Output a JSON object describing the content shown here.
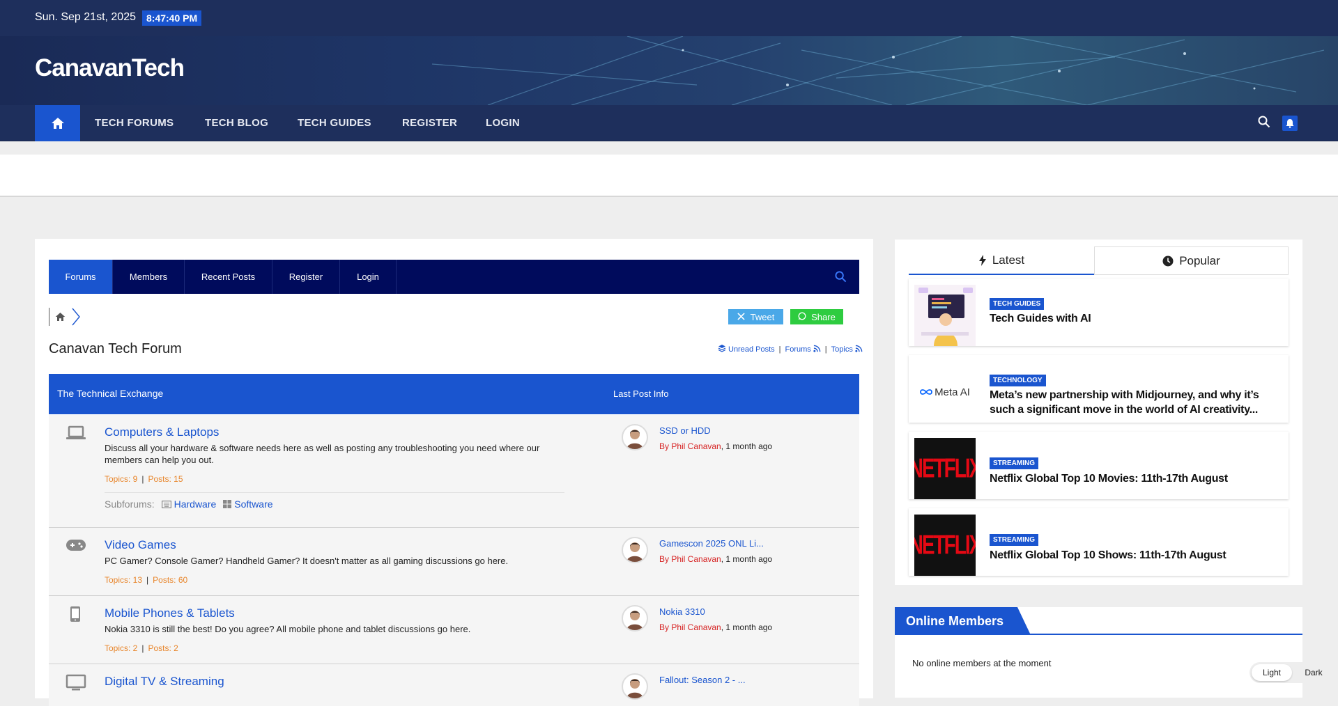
{
  "topbar": {
    "date": "Sun. Sep 21st, 2025",
    "time": "8:47:40 PM"
  },
  "site": {
    "brand": "CanavanTech"
  },
  "nav": {
    "items": [
      "TECH FORUMS",
      "TECH BLOG",
      "TECH GUIDES",
      "REGISTER",
      "LOGIN"
    ]
  },
  "forum_nav": {
    "tabs": [
      "Forums",
      "Members",
      "Recent Posts",
      "Register",
      "Login"
    ]
  },
  "share": {
    "tweet": "Tweet",
    "share": "Share"
  },
  "forum": {
    "title": "Canavan Tech Forum",
    "links": {
      "unread": "Unread Posts",
      "forums": "Forums",
      "topics": "Topics",
      "sep": "|"
    },
    "category": "The Technical Exchange",
    "last_post_header": "Last Post Info",
    "rows": [
      {
        "title": "Computers & Laptops",
        "desc": "Discuss all your hardware & software needs here as well as posting any troubleshooting you need where our members can help you out.",
        "topics": "Topics: 9",
        "posts": "Posts: 15",
        "subforums_label": "Subforums:",
        "subforums": [
          "Hardware",
          "Software"
        ],
        "last_title": "SSD or HDD",
        "last_by": "By Phil Canavan",
        "last_ago": ", 1 month ago"
      },
      {
        "title": "Video Games",
        "desc": "PC Gamer? Console Gamer? Handheld Gamer? It doesn't matter as all gaming discussions go here.",
        "topics": "Topics: 13",
        "posts": "Posts: 60",
        "last_title": "Gamescon 2025 ONL Li...",
        "last_by": "By Phil Canavan",
        "last_ago": ", 1 month ago"
      },
      {
        "title": "Mobile Phones & Tablets",
        "desc": "Nokia 3310 is still the best! Do you agree? All mobile phone and tablet discussions go here.",
        "topics": "Topics: 2",
        "posts": "Posts: 2",
        "last_title": "Nokia 3310",
        "last_by": "By Phil Canavan",
        "last_ago": ", 1 month ago"
      },
      {
        "title": "Digital TV & Streaming",
        "last_title": "Fallout: Season 2 - ..."
      }
    ],
    "stats_sep": "|"
  },
  "sidebar": {
    "tabs": {
      "latest": "Latest",
      "popular": "Popular"
    },
    "posts": [
      {
        "tag": "TECH GUIDES",
        "title": "Tech Guides with AI"
      },
      {
        "tag": "TECHNOLOGY",
        "title": "Meta’s new partnership with Midjourney, and why it’s such a significant move in the world of AI creativity...",
        "thumb_text": "Meta AI"
      },
      {
        "tag": "STREAMING",
        "title": "Netflix Global Top 10 Movies: 11th-17th August",
        "thumb_text": "NETFLIX"
      },
      {
        "tag": "STREAMING",
        "title": "Netflix Global Top 10 Shows: 11th-17th August",
        "thumb_text": "NETFLIX"
      }
    ],
    "online": {
      "title": "Online Members",
      "message": "No online members at the moment"
    }
  },
  "mode": {
    "light": "Light",
    "dark": "Dark"
  },
  "colors": {
    "accent": "#1a55cf",
    "navy": "#1e2f5c",
    "forum_nav": "#000b5c",
    "orange": "#e8852a",
    "red": "#d62222"
  }
}
